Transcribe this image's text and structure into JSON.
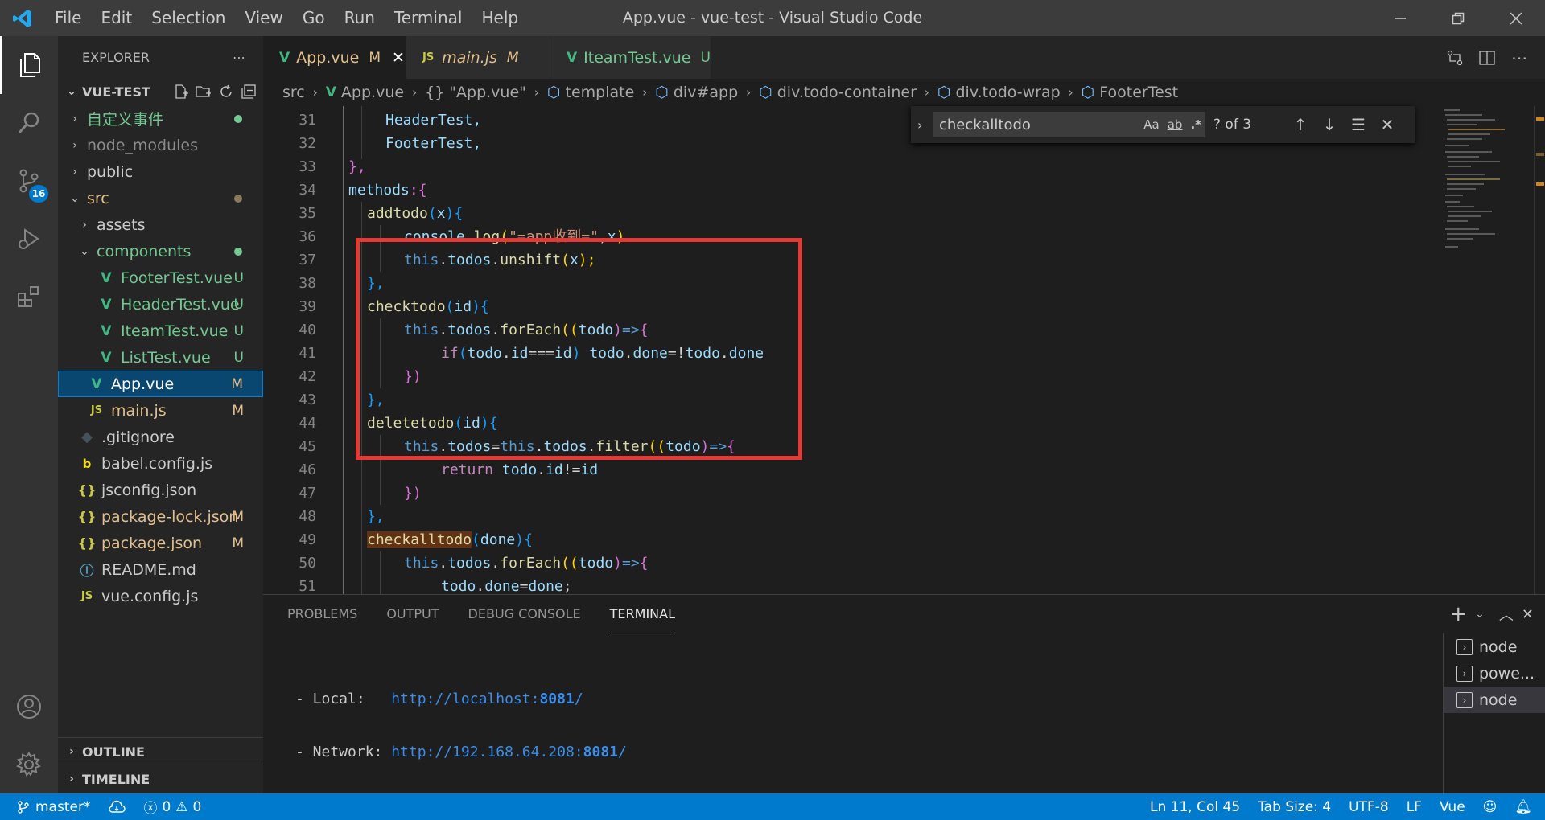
{
  "window": {
    "title": "App.vue - vue-test - Visual Studio Code"
  },
  "menu": [
    "File",
    "Edit",
    "Selection",
    "View",
    "Go",
    "Run",
    "Terminal",
    "Help"
  ],
  "activity": {
    "scm_badge": "16"
  },
  "explorer": {
    "title": "EXPLORER",
    "project": "VUE-TEST",
    "items": [
      {
        "label": "自定义事件",
        "decor": ""
      },
      {
        "label": "node_modules",
        "decor": ""
      },
      {
        "label": "public",
        "decor": ""
      },
      {
        "label": "src",
        "decor": ""
      },
      {
        "label": "assets",
        "decor": ""
      },
      {
        "label": "components",
        "decor": ""
      },
      {
        "label": "FooterTest.vue",
        "decor": "U"
      },
      {
        "label": "HeaderTest.vue",
        "decor": "U"
      },
      {
        "label": "IteamTest.vue",
        "decor": "U"
      },
      {
        "label": "ListTest.vue",
        "decor": "U"
      },
      {
        "label": "App.vue",
        "decor": "M"
      },
      {
        "label": "main.js",
        "decor": "M"
      },
      {
        "label": ".gitignore",
        "decor": ""
      },
      {
        "label": "babel.config.js",
        "decor": ""
      },
      {
        "label": "jsconfig.json",
        "decor": ""
      },
      {
        "label": "package-lock.json",
        "decor": "M"
      },
      {
        "label": "package.json",
        "decor": "M"
      },
      {
        "label": "README.md",
        "decor": ""
      },
      {
        "label": "vue.config.js",
        "decor": ""
      }
    ],
    "outline": "OUTLINE",
    "timeline": "TIMELINE"
  },
  "tabs": [
    {
      "label": "App.vue",
      "decor": "M"
    },
    {
      "label": "main.js",
      "decor": "M"
    },
    {
      "label": "IteamTest.vue",
      "decor": "U"
    }
  ],
  "breadcrumbs": [
    "src",
    "App.vue",
    "{} \"App.vue\"",
    "template",
    "div#app",
    "div.todo-container",
    "div.todo-wrap",
    "FooterTest"
  ],
  "find": {
    "query": "checkalltodo",
    "case_label": "Aa",
    "word_label": "ab",
    "regex_label": ".*",
    "count": "? of 3"
  },
  "editor": {
    "line_numbers": [
      "31",
      "32",
      "33",
      "34",
      "35",
      "36",
      "37",
      "38",
      "39",
      "40",
      "41",
      "42",
      "43",
      "44",
      "45",
      "46",
      "47",
      "48",
      "49",
      "50",
      "51"
    ],
    "code": {
      "l31": "HeaderTest,",
      "l32": "FooterTest,",
      "l33": "},",
      "l34a": "methods",
      "l34b": ":{",
      "l35a": "addtodo",
      "l35b": "(",
      "l35c": "x",
      "l35d": "){",
      "l36a": "console",
      "l36b": ".",
      "l36c": "log",
      "l36d": "(",
      "l36e": "\"=app收到=\"",
      "l36f": ",",
      "l36g": "x",
      "l36h": ")",
      "l37a": "this",
      "l37b": ".",
      "l37c": "todos",
      "l37d": ".",
      "l37e": "unshift",
      "l37f": "(",
      "l37g": "x",
      "l37h": ");",
      "l38": "},",
      "l39a": "checktodo",
      "l39b": "(",
      "l39c": "id",
      "l39d": "){",
      "l40a": "this",
      "l40b": ".",
      "l40c": "todos",
      "l40d": ".",
      "l40e": "forEach",
      "l40f": "((",
      "l40g": "todo",
      "l40h": ")",
      "l40i": "=>",
      "l40j": "{",
      "l41a": "if",
      "l41b": "(",
      "l41c": "todo",
      "l41d": ".",
      "l41e": "id",
      "l41f": "===",
      "l41g": "id",
      "l41h": ") ",
      "l41i": "todo",
      "l41j": ".",
      "l41k": "done",
      "l41l": "=!",
      "l41m": "todo",
      "l41n": ".",
      "l41o": "done",
      "l42": "})",
      "l43": "},",
      "l44a": "deletetodo",
      "l44b": "(",
      "l44c": "id",
      "l44d": "){",
      "l45a": "this",
      "l45b": ".",
      "l45c": "todos",
      "l45d": "=",
      "l45e": "this",
      "l45f": ".",
      "l45g": "todos",
      "l45h": ".",
      "l45i": "filter",
      "l45j": "((",
      "l45k": "todo",
      "l45l": ")",
      "l45m": "=>",
      "l45n": "{",
      "l46a": "return",
      "l46b": " ",
      "l46c": "todo",
      "l46d": ".",
      "l46e": "id",
      "l46f": "!=",
      "l46g": "id",
      "l47": "})",
      "l48": "},",
      "l49a": "checkalltodo",
      "l49b": "(",
      "l49c": "done",
      "l49d": "){",
      "l50a": "this",
      "l50b": ".",
      "l50c": "todos",
      "l50d": ".",
      "l50e": "forEach",
      "l50f": "((",
      "l50g": "todo",
      "l50h": ")",
      "l50i": "=>",
      "l50j": "{",
      "l51a": "todo",
      "l51b": ".",
      "l51c": "done",
      "l51d": "=",
      "l51e": "done",
      "l51f": ";"
    }
  },
  "panel": {
    "tabs": [
      "PROBLEMS",
      "OUTPUT",
      "DEBUG CONSOLE",
      "TERMINAL"
    ],
    "terminal": {
      "local_label": "- Local:   ",
      "local_url_a": "http://localhost:",
      "local_url_port": "8081",
      "local_url_b": "/",
      "net_label": "- Network: ",
      "net_url_a": "http://192.168.64.208:",
      "net_url_port": "8081",
      "net_url_b": "/"
    },
    "terminals": [
      "node",
      "powe...",
      "node"
    ]
  },
  "status": {
    "branch": "master*",
    "errors": "0",
    "warnings": "0",
    "position": "Ln 11, Col 45",
    "tab_size": "Tab Size: 4",
    "encoding": "UTF-8",
    "eol": "LF",
    "language": "Vue"
  },
  "colors": {
    "accent": "#007acc",
    "highlight_box": "#e53935",
    "git_untracked": "#73c991",
    "git_modified": "#e2c08d"
  }
}
